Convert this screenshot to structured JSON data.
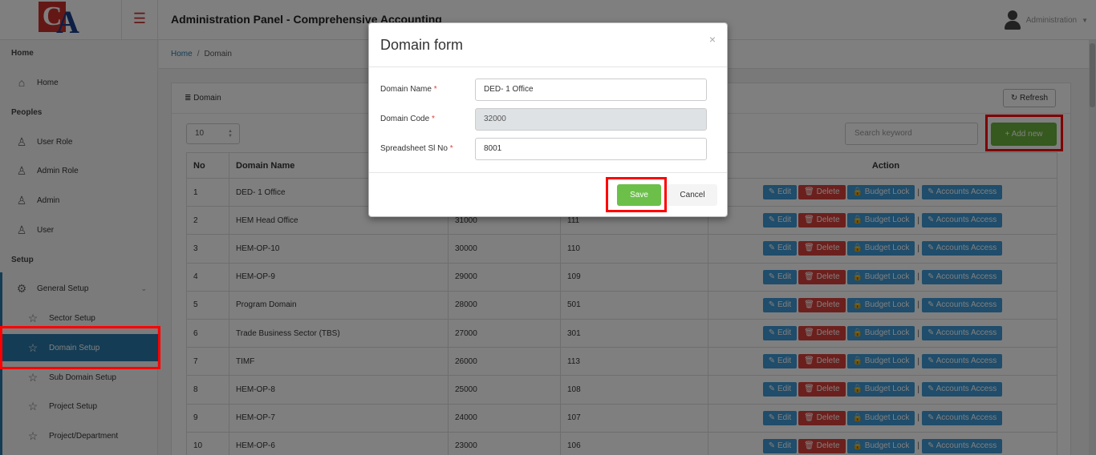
{
  "header": {
    "logo_text_c": "C",
    "logo_text_a": "A",
    "title": "Administration Panel - Comprehensive Accounting",
    "user": "Administration"
  },
  "breadcrumb": {
    "home": "Home",
    "separator": "/",
    "current": "Domain"
  },
  "sidebar": {
    "sections": [
      {
        "label": "Home"
      },
      {
        "label": "Peoples"
      },
      {
        "label": "Setup"
      }
    ],
    "items": [
      {
        "label": "Home",
        "icon": "home-icon"
      },
      {
        "label": "User Role",
        "icon": "user-icon"
      },
      {
        "label": "Admin Role",
        "icon": "user-icon"
      },
      {
        "label": "Admin",
        "icon": "user-icon"
      },
      {
        "label": "User",
        "icon": "user-icon"
      },
      {
        "label": "General Setup",
        "icon": "gear-icon"
      },
      {
        "label": "Sector Setup",
        "icon": "star-icon"
      },
      {
        "label": "Domain Setup",
        "icon": "star-icon",
        "active": true
      },
      {
        "label": "Sub Domain Setup",
        "icon": "star-icon"
      },
      {
        "label": "Project Setup",
        "icon": "star-icon"
      },
      {
        "label": "Project/Department",
        "icon": "star-icon"
      }
    ]
  },
  "panel": {
    "title": "Domain",
    "refresh_label": "Refresh",
    "page_size": "10",
    "search_placeholder": "Search keyword",
    "add_label": "Add new"
  },
  "table": {
    "headers": {
      "no": "No",
      "domain_name": "Domain Name",
      "code": "",
      "sl": "",
      "action": "Action"
    },
    "actions": {
      "edit": "Edit",
      "delete": "Delete",
      "budget": "Budget Lock",
      "accounts": "Accounts Access"
    },
    "rows": [
      {
        "no": "1",
        "name": "DED- 1 Office",
        "code": "",
        "sl": ""
      },
      {
        "no": "2",
        "name": "HEM Head Office",
        "code": "31000",
        "sl": "111"
      },
      {
        "no": "3",
        "name": "HEM-OP-10",
        "code": "30000",
        "sl": "110"
      },
      {
        "no": "4",
        "name": "HEM-OP-9",
        "code": "29000",
        "sl": "109"
      },
      {
        "no": "5",
        "name": "Program Domain",
        "code": "28000",
        "sl": "501"
      },
      {
        "no": "6",
        "name": "Trade Business Sector (TBS)",
        "code": "27000",
        "sl": "301"
      },
      {
        "no": "7",
        "name": "TIMF",
        "code": "26000",
        "sl": "113"
      },
      {
        "no": "8",
        "name": "HEM-OP-8",
        "code": "25000",
        "sl": "108"
      },
      {
        "no": "9",
        "name": "HEM-OP-7",
        "code": "24000",
        "sl": "107"
      },
      {
        "no": "10",
        "name": "HEM-OP-6",
        "code": "23000",
        "sl": "106"
      }
    ]
  },
  "modal": {
    "title": "Domain form",
    "close": "×",
    "fields": {
      "domain_name": {
        "label": "Domain Name",
        "value": "DED- 1 Office"
      },
      "domain_code": {
        "label": "Domain Code",
        "value": "32000"
      },
      "sl_no": {
        "label": "Spreadsheet Sl No",
        "value": "8001"
      }
    },
    "required_mark": "*",
    "save_label": "Save",
    "cancel_label": "Cancel"
  },
  "colors": {
    "accent": "#2879a8",
    "add_green": "#6bb23c",
    "save_green": "#6cc04a",
    "danger": "#d9413a",
    "highlight": "#ff0000"
  }
}
